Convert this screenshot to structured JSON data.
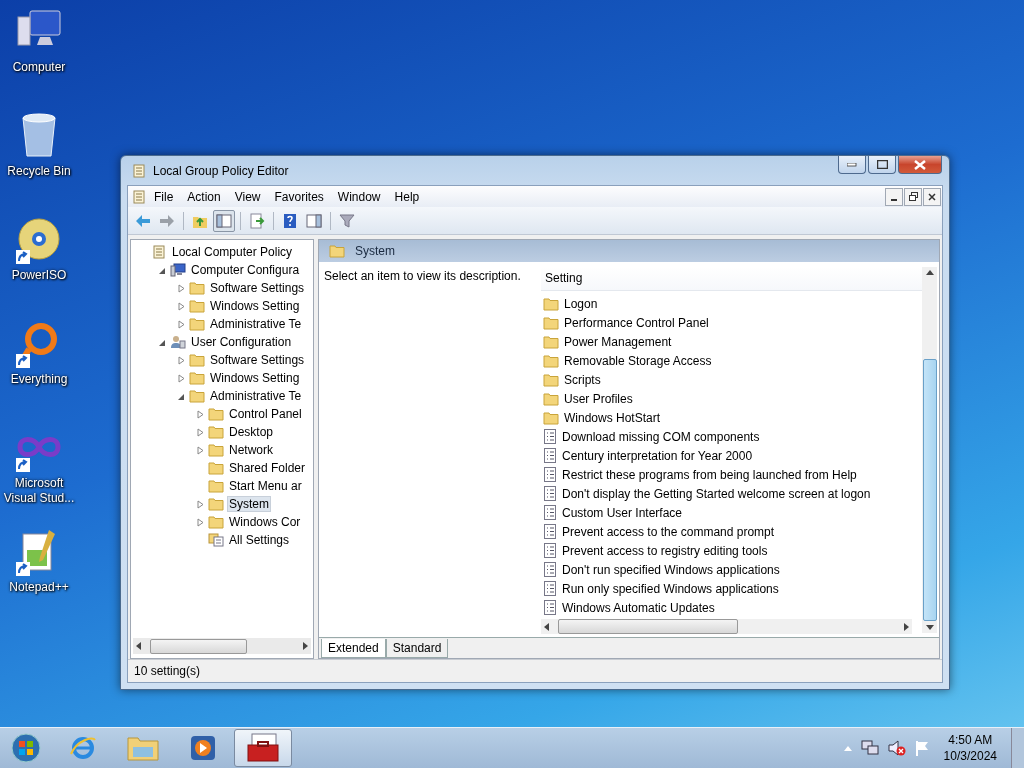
{
  "desktop_icons": [
    {
      "kind": "computer",
      "label": "Computer",
      "shortcut": false
    },
    {
      "kind": "recycle-bin",
      "label": "Recycle Bin",
      "shortcut": false
    },
    {
      "kind": "disc",
      "label": "PowerISO",
      "shortcut": true
    },
    {
      "kind": "ring",
      "label": "Everything",
      "shortcut": true
    },
    {
      "kind": "infinity",
      "label": "Microsoft Visual Stud...",
      "shortcut": true
    },
    {
      "kind": "notepad",
      "label": "Notepad++",
      "shortcut": true
    }
  ],
  "window": {
    "title": "Local Group Policy Editor",
    "menu": [
      "File",
      "Action",
      "View",
      "Favorites",
      "Window",
      "Help"
    ],
    "toolbar": [
      {
        "kind": "back",
        "pressed": false
      },
      {
        "kind": "forward",
        "pressed": false
      },
      {
        "kind": "sep"
      },
      {
        "kind": "up",
        "pressed": false
      },
      {
        "kind": "tree",
        "pressed": true
      },
      {
        "kind": "sep"
      },
      {
        "kind": "export",
        "pressed": false
      },
      {
        "kind": "sep"
      },
      {
        "kind": "help",
        "pressed": false
      },
      {
        "kind": "pane",
        "pressed": false
      },
      {
        "kind": "sep"
      },
      {
        "kind": "filter",
        "pressed": false
      }
    ],
    "tree": [
      {
        "label": "Local Computer Policy",
        "kind": "policy",
        "selected": false,
        "children": [
          {
            "label": "Computer Configura",
            "kind": "computer",
            "expanded": true,
            "selected": false,
            "children": [
              {
                "label": "Software Settings",
                "kind": "folder",
                "expanded": false,
                "selected": false
              },
              {
                "label": "Windows Setting",
                "kind": "folder",
                "expanded": false,
                "selected": false
              },
              {
                "label": "Administrative Te",
                "kind": "folder",
                "expanded": false,
                "selected": false
              }
            ]
          },
          {
            "label": "User Configuration",
            "kind": "user",
            "expanded": true,
            "selected": false,
            "children": [
              {
                "label": "Software Settings",
                "kind": "folder",
                "expanded": false,
                "selected": false
              },
              {
                "label": "Windows Setting",
                "kind": "folder",
                "expanded": false,
                "selected": false
              },
              {
                "label": "Administrative Te",
                "kind": "folder",
                "expanded": true,
                "selected": false,
                "children": [
                  {
                    "label": "Control Panel",
                    "kind": "folder",
                    "expanded": false,
                    "selected": false
                  },
                  {
                    "label": "Desktop",
                    "kind": "folder",
                    "expanded": false,
                    "selected": false
                  },
                  {
                    "label": "Network",
                    "kind": "folder",
                    "expanded": false,
                    "selected": false
                  },
                  {
                    "label": "Shared Folder",
                    "kind": "folder",
                    "selected": false
                  },
                  {
                    "label": "Start Menu ar",
                    "kind": "folder",
                    "selected": false
                  },
                  {
                    "label": "System",
                    "kind": "folder",
                    "expanded": false,
                    "selected": true
                  },
                  {
                    "label": "Windows Cor",
                    "kind": "folder",
                    "expanded": false,
                    "selected": false
                  },
                  {
                    "label": "All Settings",
                    "kind": "settings",
                    "selected": false
                  }
                ]
              }
            ]
          }
        ]
      }
    ],
    "header": "System",
    "description": "Select an item to view its description.",
    "column": "Setting",
    "settings": [
      {
        "kind": "folder",
        "label": "Logon"
      },
      {
        "kind": "folder",
        "label": "Performance Control Panel"
      },
      {
        "kind": "folder",
        "label": "Power Management"
      },
      {
        "kind": "folder",
        "label": "Removable Storage Access"
      },
      {
        "kind": "folder",
        "label": "Scripts"
      },
      {
        "kind": "folder",
        "label": "User Profiles"
      },
      {
        "kind": "folder",
        "label": "Windows HotStart"
      },
      {
        "kind": "policy",
        "label": "Download missing COM components"
      },
      {
        "kind": "policy",
        "label": "Century interpretation for Year 2000"
      },
      {
        "kind": "policy",
        "label": "Restrict these programs from being launched from Help"
      },
      {
        "kind": "policy",
        "label": "Don't display the Getting Started welcome screen at logon"
      },
      {
        "kind": "policy",
        "label": "Custom User Interface"
      },
      {
        "kind": "policy",
        "label": "Prevent access to the command prompt"
      },
      {
        "kind": "policy",
        "label": "Prevent access to registry editing tools"
      },
      {
        "kind": "policy",
        "label": "Don't run specified Windows applications"
      },
      {
        "kind": "policy",
        "label": "Run only specified Windows applications"
      },
      {
        "kind": "policy",
        "label": "Windows Automatic Updates"
      }
    ],
    "tabs": [
      {
        "label": "Extended",
        "selected": true
      },
      {
        "label": "Standard",
        "selected": false
      }
    ],
    "status": "10 setting(s)"
  },
  "taskbar": {
    "items": [
      {
        "kind": "ie",
        "active": false
      },
      {
        "kind": "explorer",
        "active": false
      },
      {
        "kind": "media",
        "active": false
      },
      {
        "kind": "toolbox",
        "active": true
      }
    ],
    "time": "4:50 AM",
    "date": "10/3/2024"
  }
}
